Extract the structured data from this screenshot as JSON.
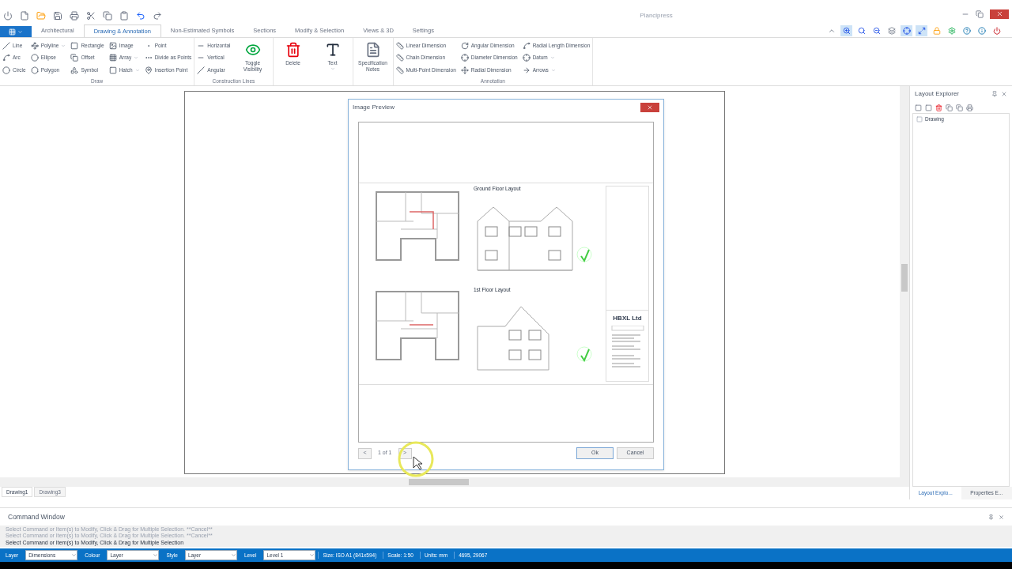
{
  "app_title": "Plancipress",
  "ribbon_tabs": [
    {
      "label": "Architectural",
      "selected": false
    },
    {
      "label": "Drawing & Annotation",
      "selected": true
    },
    {
      "label": "Non-Estimated Symbols",
      "selected": false
    },
    {
      "label": "Sections",
      "selected": false
    },
    {
      "label": "Modify & Selection",
      "selected": false
    },
    {
      "label": "Views & 3D",
      "selected": false
    },
    {
      "label": "Settings",
      "selected": false
    }
  ],
  "view_tools": [
    {
      "selected": false
    },
    {
      "selected": true
    },
    {
      "selected": false
    },
    {
      "selected": false
    },
    {
      "selected": false
    },
    {
      "selected": true
    },
    {
      "selected": true
    },
    {
      "selected": false
    },
    {
      "selected": false
    },
    {
      "selected": false
    },
    {
      "selected": false
    },
    {
      "selected": false
    }
  ],
  "ribbon_groups": [
    {
      "label": "Draw",
      "columns": [
        {
          "kind": "stack",
          "items": [
            {
              "label": "Line",
              "dropdown": false
            },
            {
              "label": "Arc",
              "dropdown": false
            },
            {
              "label": "Circle",
              "dropdown": false
            }
          ]
        },
        {
          "kind": "stack",
          "items": [
            {
              "label": "Polyline",
              "dropdown": true
            },
            {
              "label": "Ellipse",
              "dropdown": false
            },
            {
              "label": "Polygon",
              "dropdown": false
            }
          ]
        },
        {
          "kind": "stack",
          "items": [
            {
              "label": "Rectangle",
              "dropdown": false
            },
            {
              "label": "Offset",
              "dropdown": false
            },
            {
              "label": "Symbol",
              "dropdown": false
            }
          ]
        },
        {
          "kind": "stack",
          "items": [
            {
              "label": "Image",
              "dropdown": false
            },
            {
              "label": "Array",
              "dropdown": true
            },
            {
              "label": "Hatch",
              "dropdown": true
            }
          ]
        },
        {
          "kind": "stack",
          "items": [
            {
              "label": "Point",
              "dropdown": false
            },
            {
              "label": "Divide as Points",
              "dropdown": false
            },
            {
              "label": "Insertion Point",
              "dropdown": false
            }
          ]
        }
      ]
    },
    {
      "label": "Construction Lines",
      "columns": [
        {
          "kind": "stack",
          "items": [
            {
              "label": "Horizontal",
              "dropdown": false
            },
            {
              "label": "Vertical",
              "dropdown": false
            },
            {
              "label": "Angular",
              "dropdown": false
            }
          ]
        },
        {
          "kind": "large",
          "label": "Toggle Visibility",
          "dropdown": false
        }
      ]
    },
    {
      "columns": [
        {
          "kind": "large",
          "label": "Delete",
          "dropdown": false
        },
        {
          "kind": "large",
          "label": "Text",
          "dropdown": true
        }
      ]
    },
    {
      "columns": [
        {
          "kind": "large",
          "label": "Specification Notes",
          "dropdown": false
        }
      ]
    },
    {
      "label": "Annotation",
      "columns": [
        {
          "kind": "stack",
          "items": [
            {
              "label": "Linear Dimension",
              "dropdown": false
            },
            {
              "label": "Chain Dimension",
              "dropdown": false
            },
            {
              "label": "Multi-Point Dimension",
              "dropdown": false
            }
          ]
        },
        {
          "kind": "stack",
          "items": [
            {
              "label": "Angular Dimension",
              "dropdown": false
            },
            {
              "label": "Diameter Dimension",
              "dropdown": false
            },
            {
              "label": "Radial Dimension",
              "dropdown": false
            }
          ]
        },
        {
          "kind": "stack",
          "items": [
            {
              "label": "Radial Length Dimension",
              "dropdown": false
            },
            {
              "label": "Datum",
              "dropdown": true
            },
            {
              "label": "Arrows",
              "dropdown": true
            }
          ]
        }
      ]
    }
  ],
  "dialog": {
    "title": "Image Preview",
    "sheet": {
      "ground_title": "Ground Floor Layout",
      "first_title": "1st Floor Layout",
      "company": "HBXL Ltd"
    },
    "prev": "<",
    "page": "1 of 1",
    "next": ">",
    "buttons": [
      "Ok",
      "Cancel"
    ]
  },
  "document_tabs": [
    {
      "label": "Drawing1",
      "selected": true
    },
    {
      "label": "Drawing3",
      "selected": false
    }
  ],
  "layout_explorer": {
    "title": "Layout Explorer",
    "tree": [
      {
        "label": "Drawing"
      }
    ],
    "tabs": [
      {
        "label": "Layout Explo...",
        "selected": true
      },
      {
        "label": "Properties E...",
        "selected": false
      }
    ]
  },
  "command_window": {
    "title": "Command Window",
    "lines": [
      {
        "text": "Select Command or Item(s) to Modify, Click & Drag for Multiple Selection. **Cancel**",
        "active": false
      },
      {
        "text": "Select Command or Item(s) to Modify, Click & Drag for Multiple Selection. **Cancel**",
        "active": false
      },
      {
        "text": "Select Command or Item(s) to Modify, Click & Drag for Multiple Selection",
        "active": true
      }
    ]
  },
  "status_bar": {
    "fields": [
      {
        "label": "Layer",
        "value": "Dimensions"
      },
      {
        "label": "Colour",
        "value": "Layer"
      },
      {
        "label": "Style",
        "value": "Layer"
      },
      {
        "label": "Level",
        "value": "Level 1"
      }
    ],
    "info": [
      "Size: ISO A1 (841x594)",
      "Scale: 1:50",
      "Units: mm",
      "4695, 29067"
    ]
  }
}
